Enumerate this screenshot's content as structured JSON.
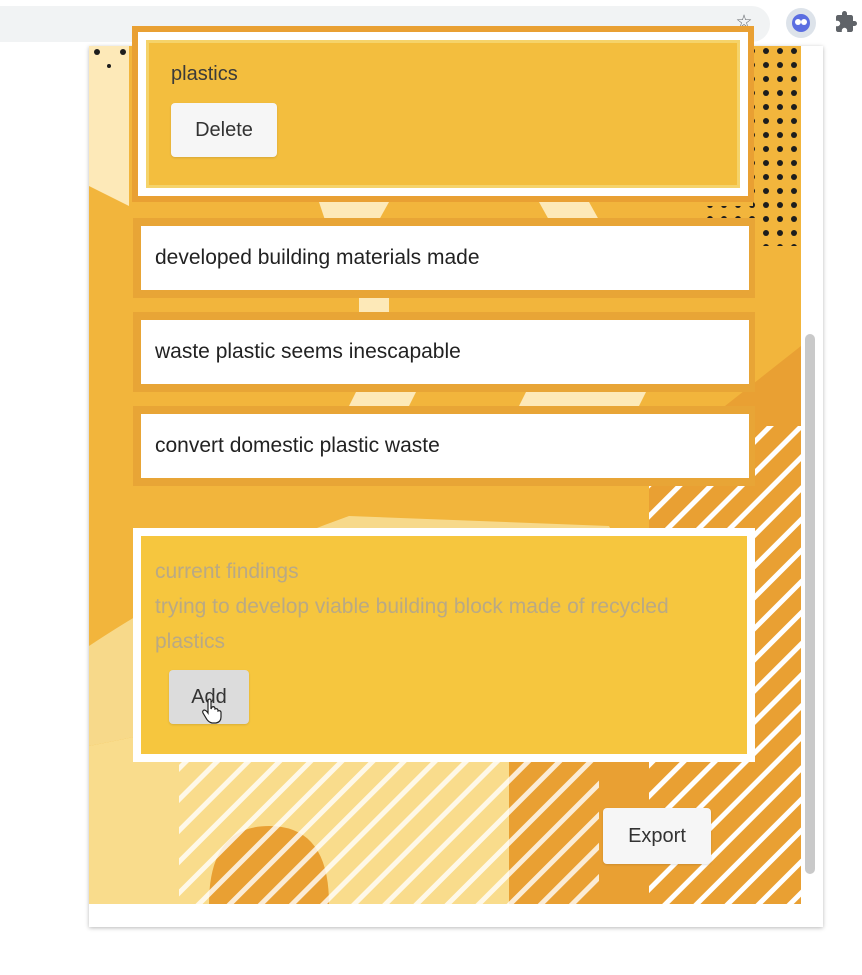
{
  "toolbar": {
    "icons": [
      "star-icon",
      "owl-extension-icon",
      "puzzle-extensions-icon"
    ],
    "star_glyph": "☆"
  },
  "popup": {
    "expanded_card": {
      "text": "plastics",
      "delete_label": "Delete"
    },
    "items": [
      {
        "text": "developed building materials made"
      },
      {
        "text": "waste plastic seems inescapable"
      },
      {
        "text": "convert domestic plastic waste"
      }
    ],
    "add_card": {
      "placeholder": "current findings\ntrying to develop viable building block made of recycled plastics",
      "add_label": "Add"
    },
    "export_label": "Export"
  },
  "colors": {
    "background": "#f2b53c",
    "card": "#f6c63e",
    "accent": "#e9a033"
  }
}
